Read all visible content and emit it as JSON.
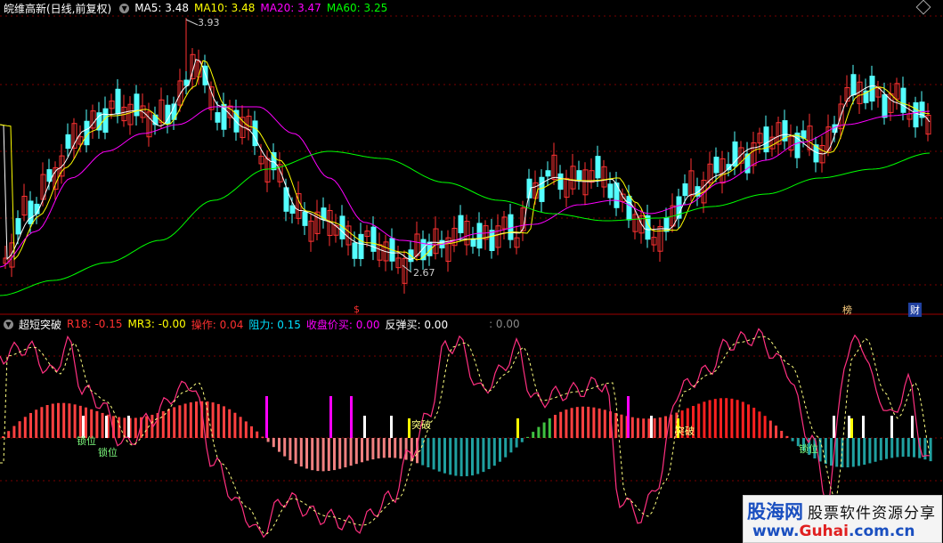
{
  "header": {
    "stock_title": "皖维高新(日线,前复权)",
    "ma_labels": [
      {
        "text": "MA5: 3.48",
        "color": "#ffffff"
      },
      {
        "text": "MA10: 3.48",
        "color": "#ffff00"
      },
      {
        "text": "MA20: 3.47",
        "color": "#ff00ff"
      },
      {
        "text": "MA60: 3.25",
        "color": "#00ff00"
      }
    ],
    "collapse_icon": "chevron-down-icon",
    "menu_icon": "diamond-icon"
  },
  "price_panel": {
    "high_label": "3.93",
    "low_label": "2.67",
    "dollar_marker": "$",
    "bang_label": "榜",
    "cai_label": "财"
  },
  "indicator": {
    "title": "超短突破",
    "values": [
      {
        "text": "R18: -0.15",
        "color": "#ff3030"
      },
      {
        "text": "MR3: -0.00",
        "color": "#ffff00"
      },
      {
        "text": "操作: 0.04",
        "color": "#ff3030"
      },
      {
        "text": "阻力: 0.15",
        "color": "#00e0ff"
      },
      {
        "text": "收盘价买: 0.00",
        "color": "#ff00ff"
      },
      {
        "text": "反弹买: 0.00",
        "color": "#ffffff"
      },
      {
        "text": ": 0.00",
        "color": "#888888"
      }
    ],
    "annotations": {
      "suo_wei": "锁位",
      "tu_po": "突破"
    }
  },
  "watermark": {
    "brand": "股海网",
    "slogan": "股票软件资源分享",
    "url_prefix": "www.",
    "url_main": "Guhai",
    "url_suffix": ".com.cn"
  },
  "colors": {
    "up": "#ff3232",
    "down": "#54ffff",
    "ma5": "#ffffff",
    "ma10": "#ffff00",
    "ma20": "#ff00ff",
    "ma60": "#00ff00",
    "grid": "#7a0000"
  }
}
